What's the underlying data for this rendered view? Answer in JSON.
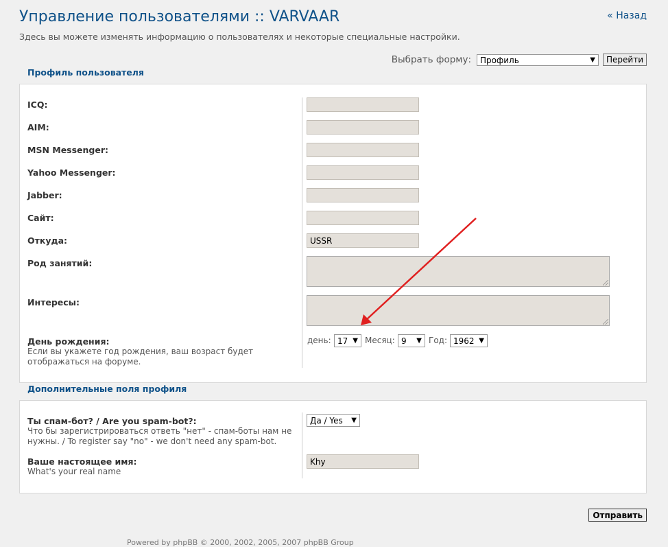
{
  "header": {
    "title": "Управление пользователями :: VARVAAR",
    "back_link": "« Назад",
    "description": "Здесь вы можете изменять информацию о пользователях и некоторые специальные настройки."
  },
  "form_select": {
    "label": "Выбрать форму:",
    "value": "Профиль",
    "go_button": "Перейти"
  },
  "profile_section": {
    "legend": "Профиль пользователя",
    "fields": [
      {
        "label": "ICQ:",
        "value": ""
      },
      {
        "label": "AIM:",
        "value": ""
      },
      {
        "label": "MSN Messenger:",
        "value": ""
      },
      {
        "label": "Yahoo Messenger:",
        "value": ""
      },
      {
        "label": "Jabber:",
        "value": ""
      },
      {
        "label": "Сайт:",
        "value": ""
      },
      {
        "label": "Откуда:",
        "value": "USSR"
      }
    ],
    "occupation_label": "Род занятий:",
    "interests_label": "Интересы:",
    "birthday": {
      "label": "День рождения:",
      "help": "Если вы укажете год рождения, ваш возраст будет отображаться на форуме.",
      "day_label": "день:",
      "day": "17",
      "month_label": "Месяц:",
      "month": "9",
      "year_label": "Год:",
      "year": "1962"
    }
  },
  "extra_section": {
    "legend": "Дополнительные поля профиля",
    "spam_label": "Ты спам-бот? / Are you spam-bot?:",
    "spam_help": "Что бы зарегистрироваться ответь \"нет\" - спам-боты нам не нужны. / To register say \"no\" - we don't need any spam-bot.",
    "spam_value": "Да / Yes",
    "realname_label": "Ваше настоящее имя:",
    "realname_help": "What's your real name",
    "realname_value": "Khy"
  },
  "submit_label": "Отправить",
  "footer_text": "Powered by phpBB © 2000, 2002, 2005, 2007 phpBB Group",
  "colors": {
    "accent": "#105289",
    "field_bg": "#e4e0da",
    "annotation_arrow": "#e02020"
  }
}
